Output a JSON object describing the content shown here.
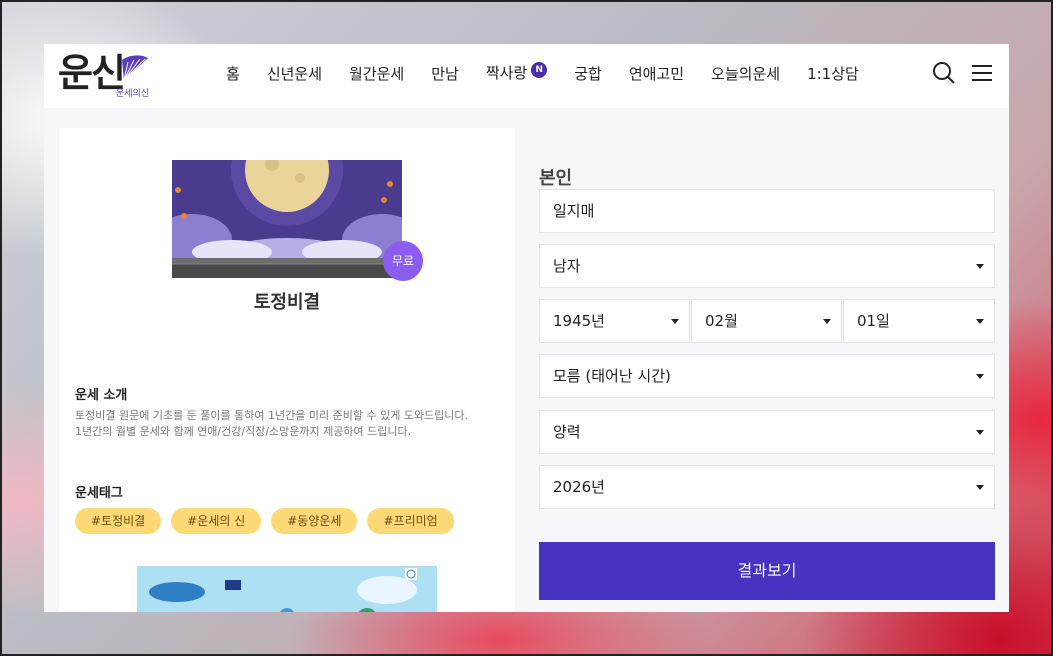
{
  "header": {
    "logo_main": "운신",
    "logo_sub": "운세의신",
    "nav": [
      {
        "label": "홈"
      },
      {
        "label": "신년운세"
      },
      {
        "label": "월간운세"
      },
      {
        "label": "만남"
      },
      {
        "label": "짝사랑",
        "badge": "N"
      },
      {
        "label": "궁합"
      },
      {
        "label": "연애고민"
      },
      {
        "label": "오늘의운세"
      },
      {
        "label": "1:1상담"
      }
    ],
    "icons": [
      "search-icon",
      "hamburger-menu-icon"
    ]
  },
  "service": {
    "badge": "무료",
    "title": "토정비결",
    "intro_heading": "운세 소개",
    "intro_line1": "토정비결 원문에 기초를 둔 풀이를 통하여 1년간을 미리 준비할 수 있게 도와드립니다.",
    "intro_line2": "1년간의 월별 운세와 함께 연애/건강/직장/소망운까지 제공하여 드립니다.",
    "tags_heading": "운세태그",
    "tags": [
      "#토정비결",
      "#운세의 신",
      "#동양운세",
      "#프리미엄"
    ]
  },
  "form": {
    "title": "본인",
    "name": "일지매",
    "gender": "남자",
    "birth_year": "1945년",
    "birth_month": "02월",
    "birth_day": "01일",
    "birth_time": "모름 (태어난 시간)",
    "calendar": "양력",
    "target_year": "2026년",
    "submit_label": "결과보기"
  },
  "colors": {
    "accent": "#4633bf",
    "badge": "#8a5cf0",
    "tag_bg": "#fcd976"
  }
}
